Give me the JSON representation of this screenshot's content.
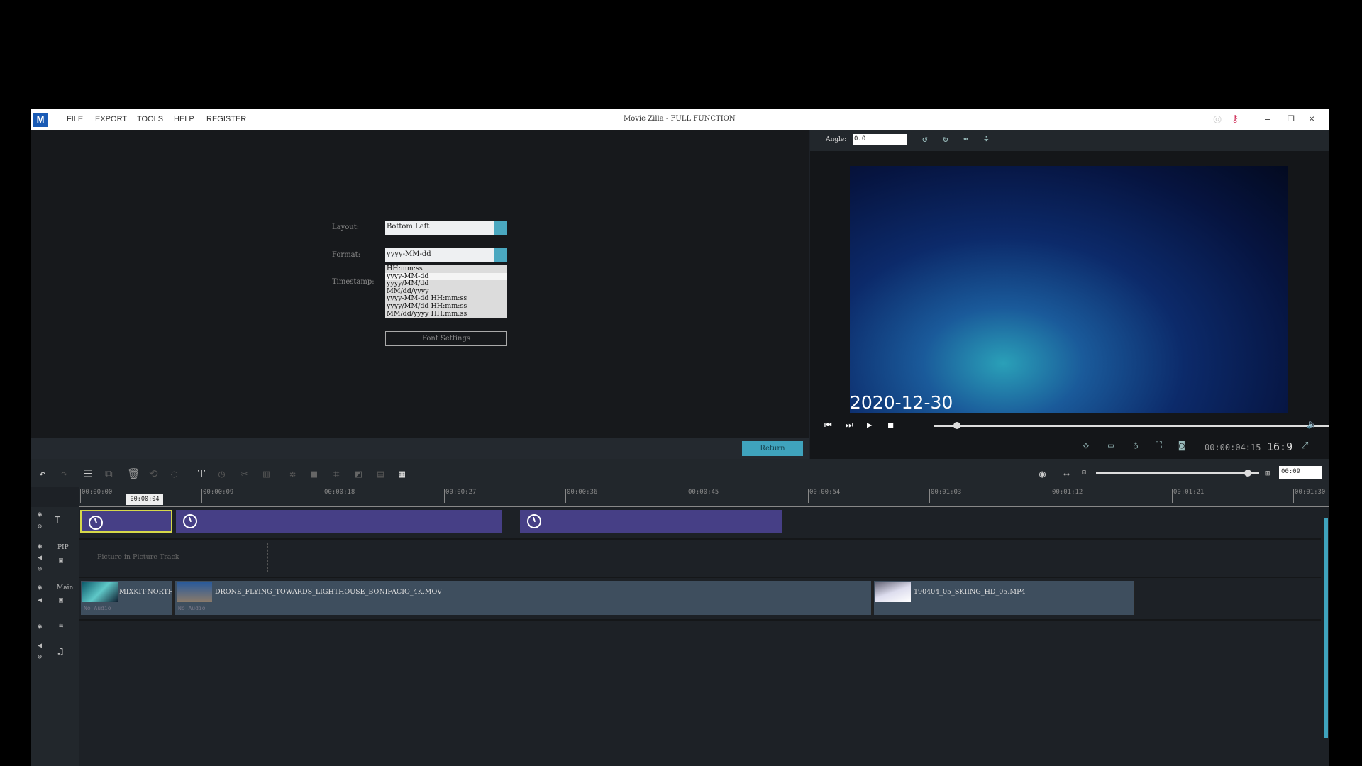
{
  "app": {
    "title": "Movie Zilla - FULL FUNCTION",
    "menu": [
      "FILE",
      "EXPORT",
      "TOOLS",
      "HELP",
      "REGISTER"
    ]
  },
  "settings": {
    "layout_label": "Layout:",
    "layout_value": "Bottom Left",
    "format_label": "Format:",
    "format_value": "yyyy-MM-dd",
    "timestamp_label": "Timestamp:",
    "format_options": [
      "HH:mm:ss",
      "yyyy-MM-dd",
      "yyyy/MM/dd",
      "MM/dd/yyyy",
      "yyyy-MM-dd HH:mm:ss",
      "yyyy/MM/dd HH:mm:ss",
      "MM/dd/yyyy HH:mm:ss"
    ],
    "font_settings": "Font Settings",
    "return": "Return"
  },
  "preview": {
    "angle_label": "Angle:",
    "angle_value": "0.0",
    "timestamp_overlay": "2020-12-30",
    "timecode": "00:00:04:15",
    "aspect": "16:9",
    "progress": 0.06
  },
  "timeline": {
    "zoom_value": "00:09",
    "zoom_level": 0.93,
    "playhead": "00:00:04",
    "ruler": [
      "00:00:00",
      "00:00:09",
      "00:00:18",
      "00:00:27",
      "00:00:36",
      "00:00:45",
      "00:00:54",
      "00:01:03",
      "00:01:12",
      "00:01:21",
      "00:01:30"
    ],
    "pip_placeholder": "Picture in Picture Track",
    "track_labels": {
      "pip": "PIP",
      "main": "Main"
    },
    "main_clips": [
      {
        "name": "MIXKIT-NORTHE",
        "audio": "No Audio"
      },
      {
        "name": "DRONE_FLYING_TOWARDS_LIGHTHOUSE_BONIFACIO_4K.MOV",
        "audio": "No Audio"
      },
      {
        "name": "190404_05_SKIING_HD_05.MP4",
        "audio": ""
      }
    ]
  },
  "colors": {
    "accent": "#3fa3bd",
    "text_clip": "#463f86",
    "selected": "#d6d84a"
  }
}
